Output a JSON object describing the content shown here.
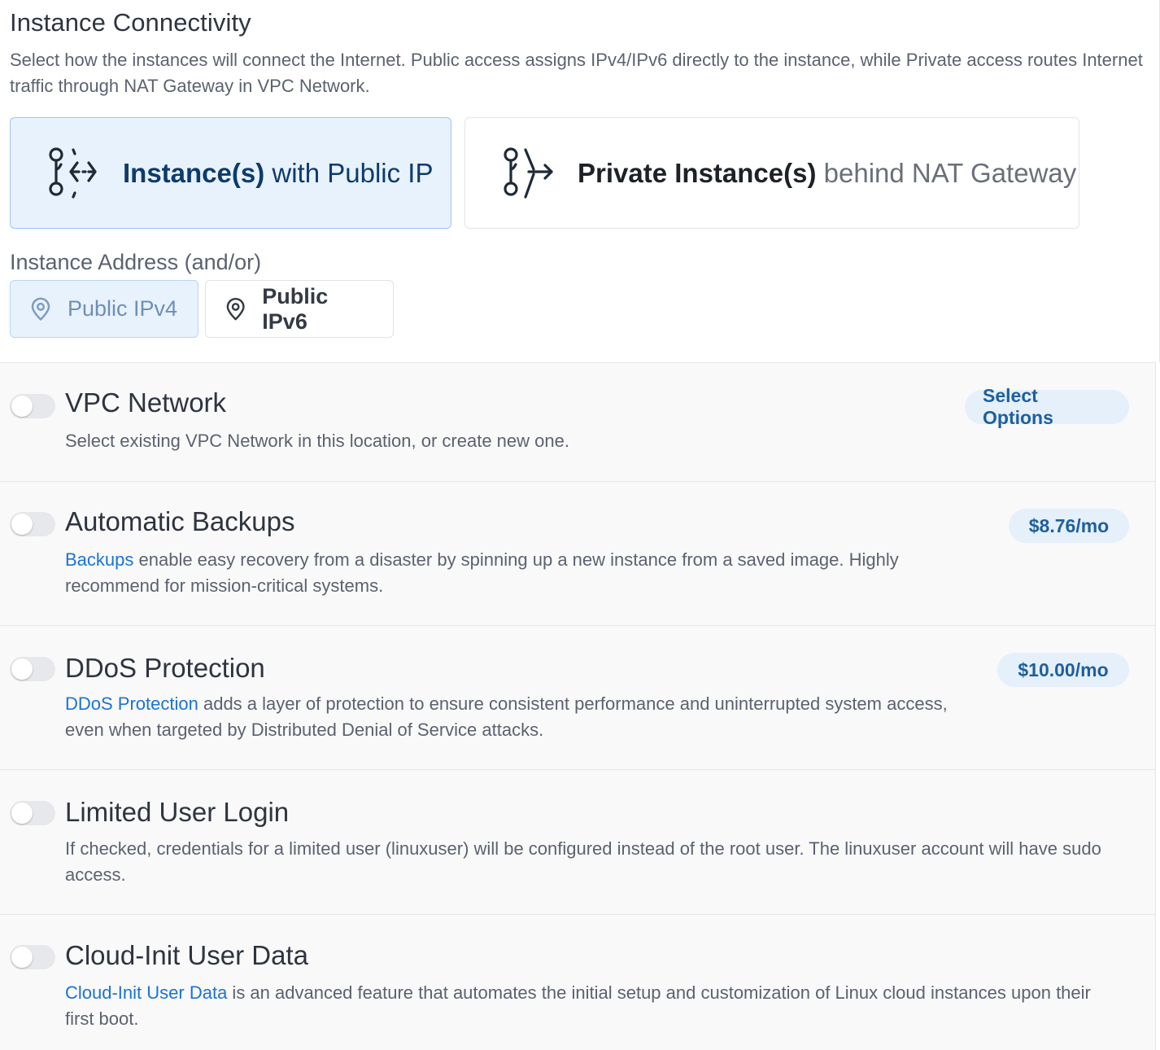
{
  "connectivity": {
    "title": "Instance Connectivity",
    "description": "Select how the instances will connect the Internet. Public access assigns IPv4/IPv6 directly to the instance, while Private access routes Internet traffic through NAT Gateway in VPC Network.",
    "public": {
      "strong": "Instance(s)",
      "rest": " with Public IP",
      "icon": "public-ip-network-icon",
      "selected": true
    },
    "private": {
      "strong": "Private Instance(s)",
      "rest": " behind NAT Gateway",
      "icon": "nat-gateway-icon",
      "selected": false
    }
  },
  "address": {
    "label": "Instance Address (and/or)",
    "ipv4": {
      "label": "Public IPv4",
      "icon": "location-pin-icon",
      "selected": true
    },
    "ipv6": {
      "label": "Public IPv6",
      "icon": "location-pin-icon",
      "selected": false
    }
  },
  "options": {
    "vpc": {
      "title": "VPC Network",
      "desc": "Select existing VPC Network in this location, or create new one.",
      "action": "Select Options",
      "enabled": false
    },
    "backups": {
      "title": "Automatic Backups",
      "link": "Backups",
      "desc": " enable easy recovery from a disaster by spinning up a new instance from a saved image. Highly recommend for mission-critical systems.",
      "price": "$8.76/mo",
      "enabled": false
    },
    "ddos": {
      "title": "DDoS Protection",
      "link": "DDoS Protection",
      "desc": " adds a layer of protection to ensure consistent performance and uninterrupted system access, even when targeted by Distributed Denial of Service attacks.",
      "price": "$10.00/mo",
      "enabled": false
    },
    "limited": {
      "title": "Limited User Login",
      "desc": "If checked, credentials for a limited user (linuxuser) will be configured instead of the root user. The linuxuser account will have sudo access.",
      "enabled": false
    },
    "cloudinit": {
      "title": "Cloud-Init User Data",
      "link": "Cloud-Init User Data",
      "desc": " is an advanced feature that automates the initial setup and customization of Linux cloud instances upon their first boot.",
      "enabled": false
    }
  },
  "colors": {
    "accent": "#1a73d9",
    "selected_bg": "#e8f2fd",
    "pill_bg": "#e5f0fb"
  }
}
